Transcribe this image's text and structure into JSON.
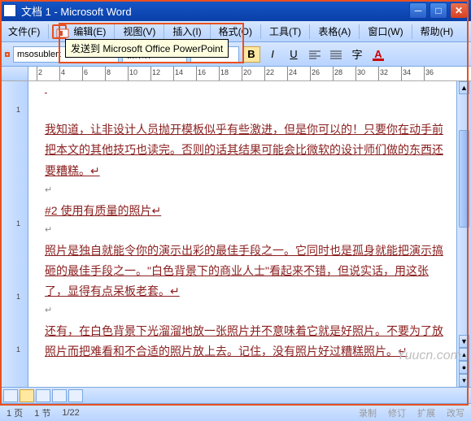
{
  "titlebar": {
    "title": "文档 1 - Microsoft Word"
  },
  "menu": {
    "file": "文件(F)",
    "edit": "编辑(E)",
    "view": "视图(V)",
    "insert": "插入(I)",
    "format": "格式(O)",
    "tools": "工具(T)",
    "table": "表格(A)",
    "window": "窗口(W)",
    "help": "帮助(H)"
  },
  "tooltip": "发送到 Microsoft Office PowerPoint",
  "toolbar": {
    "font_name": "msosublert",
    "font_style": "新宋体",
    "bold": "B",
    "italic": "I",
    "underline": "U",
    "color_a": "A"
  },
  "ruler_h": [
    "2",
    "4",
    "6",
    "8",
    "10",
    "12",
    "14",
    "16",
    "18",
    "20",
    "22",
    "24",
    "26",
    "28",
    "30",
    "32",
    "34",
    "36"
  ],
  "ruler_v": [
    "1",
    "1",
    "1",
    "1"
  ],
  "doc": {
    "p1": "我知道，让非设计人员抛开模板似乎有些激进，但是你可以的！只要你在动手前把本文的其他技巧也读完。否则的话其结果可能会比微软的设计师们做的东西还要糟糕。↵",
    "p2": "#2 使用有质量的照片↵",
    "p3": "照片是独自就能令你的演示出彩的最佳手段之一。它同时也是孤身就能把演示搞砸的最佳手段之一。\"白色背景下的商业人士\"看起来不错，但说实话，用这张了，显得有点呆板老套。↵",
    "p4": "还有，在白色背景下光溜溜地放一张照片并不意味着它就是好照片。不要为了放照片而把难看和不合适的照片放上去。记住，没有照片好过糟糕照片。↵"
  },
  "status": {
    "page": "1 页",
    "section": "1 节",
    "pages": "1/22",
    "rec": "录制",
    "rev": "修订",
    "ext": "扩展",
    "ovr": "改写"
  },
  "watermark": "Yuucn.com"
}
